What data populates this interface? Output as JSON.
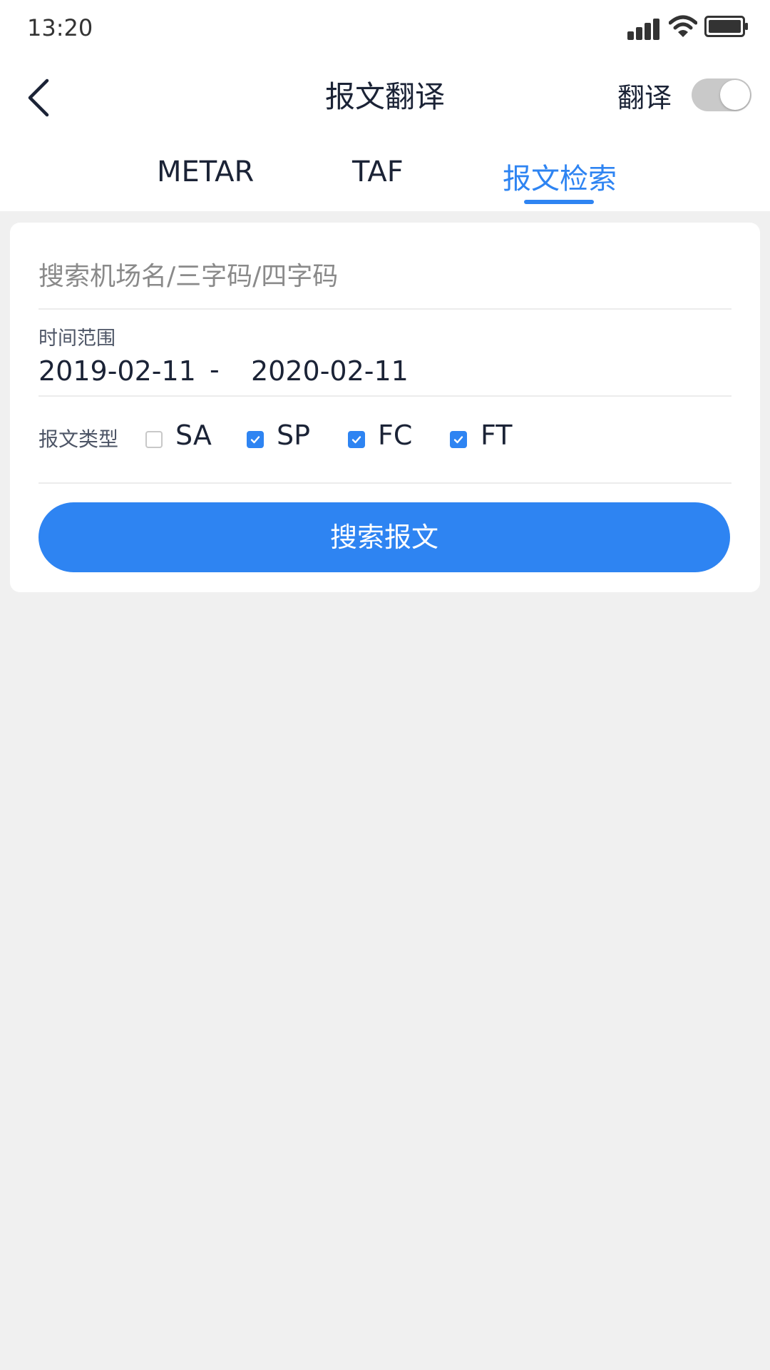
{
  "status_bar": {
    "time": "13:20"
  },
  "header": {
    "title": "报文翻译",
    "translate_label": "翻译",
    "translate_enabled": true
  },
  "tabs": [
    {
      "label": "METAR",
      "active": false
    },
    {
      "label": "TAF",
      "active": false
    },
    {
      "label": "报文检索",
      "active": true
    }
  ],
  "search": {
    "placeholder": "搜索机场名/三字码/四字码",
    "value": ""
  },
  "time_range": {
    "label": "时间范围",
    "start": "2019-02-11",
    "separator": "-",
    "end": "2020-02-11"
  },
  "message_type": {
    "label": "报文类型",
    "options": [
      {
        "label": "SA",
        "checked": false
      },
      {
        "label": "SP",
        "checked": true
      },
      {
        "label": "FC",
        "checked": true
      },
      {
        "label": "FT",
        "checked": true
      }
    ]
  },
  "search_button": {
    "label": "搜索报文"
  },
  "colors": {
    "accent": "#2e84f2",
    "background": "#f0f0f0",
    "text": "#1b2336"
  }
}
